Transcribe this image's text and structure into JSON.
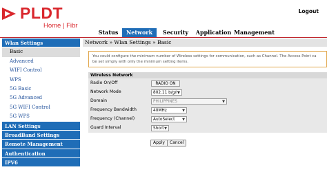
{
  "brand": {
    "name": "PLDT",
    "tagline": "Home | Fibr",
    "color": "#d9262c"
  },
  "header": {
    "logout": "Logout"
  },
  "nav": {
    "tabs": [
      {
        "label": "Status",
        "active": false
      },
      {
        "label": "Network",
        "active": true
      },
      {
        "label": "Security",
        "active": false
      },
      {
        "label": "Application",
        "active": false
      },
      {
        "label": "Management",
        "active": false
      }
    ]
  },
  "sidebar": {
    "items": [
      {
        "label": "Wlan Settings",
        "type": "section"
      },
      {
        "label": "Basic",
        "type": "sub",
        "active": true
      },
      {
        "label": "Advanced",
        "type": "sub"
      },
      {
        "label": "WIFI Control",
        "type": "sub"
      },
      {
        "label": "WPS",
        "type": "sub"
      },
      {
        "label": "5G Basic",
        "type": "sub"
      },
      {
        "label": "5G Advanced",
        "type": "sub"
      },
      {
        "label": "5G WIFI Control",
        "type": "sub"
      },
      {
        "label": "5G WPS",
        "type": "sub"
      },
      {
        "label": "LAN Settings",
        "type": "section"
      },
      {
        "label": "BroadBand Settings",
        "type": "section"
      },
      {
        "label": "Remote Management",
        "type": "section"
      },
      {
        "label": "Authentication",
        "type": "section"
      },
      {
        "label": "IPV6",
        "type": "section"
      }
    ]
  },
  "breadcrumb": "Network » Wlan Settings » Basic",
  "info": {
    "line1": "You could configure the minimum number of Wireless settings for communication, such as Channel. The Access Point ca",
    "line2": "be set simply with only the minimum setting items."
  },
  "form": {
    "title": "Wireless Network",
    "fields": [
      {
        "label": "Radio On/Off",
        "value": "RADIO ON",
        "kind": "button"
      },
      {
        "label": "Network Mode",
        "value": "802.11 b/g/n",
        "kind": "select"
      },
      {
        "label": "Domain",
        "value": "PHILIPPINES",
        "kind": "select-disabled"
      },
      {
        "label": "Frequency Bandwidth",
        "value": "40MHz",
        "kind": "select"
      },
      {
        "label": "Frequency (Channel)",
        "value": "AutoSelect",
        "kind": "select"
      },
      {
        "label": "Guard Interval",
        "value": "Short",
        "kind": "select"
      }
    ],
    "apply": "Apply",
    "cancel": "Cancel"
  },
  "colors": {
    "accent": "#1f6db7",
    "brand_red": "#c0272d",
    "info_border": "#e1a64b"
  }
}
